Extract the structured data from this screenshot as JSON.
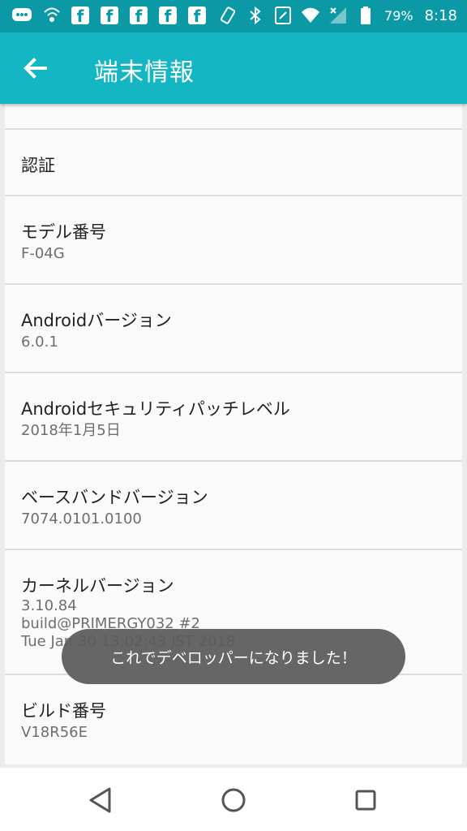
{
  "status_bar": {
    "battery_percent": "79%",
    "time": "8:18"
  },
  "app_bar": {
    "title": "端末情報"
  },
  "items": [
    {
      "title": "認証",
      "subtitle": ""
    },
    {
      "title": "モデル番号",
      "subtitle": "F-04G"
    },
    {
      "title": "Androidバージョン",
      "subtitle": "6.0.1"
    },
    {
      "title": "Androidセキュリティパッチレベル",
      "subtitle": "2018年1月5日"
    },
    {
      "title": "ベースバンドバージョン",
      "subtitle": "7074.0101.0100"
    },
    {
      "title": "カーネルバージョン",
      "subtitle": "3.10.84\nbuild@PRIMERGY032 #2\nTue Jan 30 13:02:43 JST 2018"
    },
    {
      "title": "ビルド番号",
      "subtitle": "V18R56E"
    }
  ],
  "toast": {
    "message": "これでデベロッパーになりました！"
  },
  "colors": {
    "status_bar": "#0b9aa5",
    "app_bar": "#14b6c3"
  }
}
